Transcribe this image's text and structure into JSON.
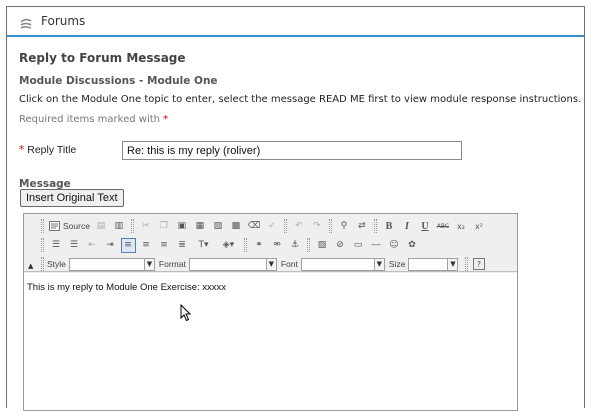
{
  "header": {
    "title": "Forums",
    "icon": "forums-icon"
  },
  "page": {
    "heading": "Reply to Forum Message",
    "module_heading": "Module Discussions - Module One",
    "instructions": "Click on the Module One topic to enter, select the message READ ME first to view module response instructions.",
    "required_note": "Required items marked with",
    "required_marker": "*"
  },
  "form": {
    "reply_title_label": "Reply Title",
    "reply_title_value": "Re: this is my reply (roliver)",
    "message_label": "Message",
    "insert_button": "Insert Original Text"
  },
  "editor": {
    "source_label": "Source",
    "style_label": "Style",
    "format_label": "Format",
    "font_label": "Font",
    "size_label": "Size",
    "content": "This is my reply to Module One Exercise: xxxxx",
    "bold": "B",
    "italic": "I",
    "underline": "U",
    "strike": "ABC",
    "subscript": "x₂",
    "superscript": "x²",
    "help": "?"
  },
  "colors": {
    "accent_line": "#3a8fcf",
    "required": "#cc0000",
    "active_button_border": "#5a7ea8"
  }
}
